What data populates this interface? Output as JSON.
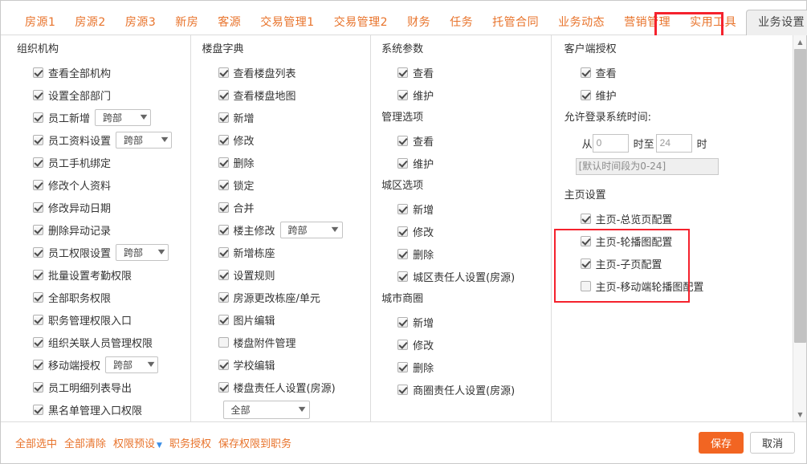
{
  "tabs": [
    {
      "label": "房源1"
    },
    {
      "label": "房源2"
    },
    {
      "label": "房源3"
    },
    {
      "label": "新房"
    },
    {
      "label": "客源"
    },
    {
      "label": "交易管理1"
    },
    {
      "label": "交易管理2"
    },
    {
      "label": "财务"
    },
    {
      "label": "任务"
    },
    {
      "label": "托管合同"
    },
    {
      "label": "业务动态"
    },
    {
      "label": "营销管理"
    },
    {
      "label": "实用工具"
    },
    {
      "label": "业务设置",
      "active": true
    }
  ],
  "columns": {
    "col1": {
      "title": "组织机构",
      "items": [
        {
          "label": "查看全部机构",
          "checked": true
        },
        {
          "label": "设置全部部门",
          "checked": true
        },
        {
          "label": "员工新增",
          "checked": true,
          "select": "跨部"
        },
        {
          "label": "员工资料设置",
          "checked": true,
          "select": "跨部"
        },
        {
          "label": "员工手机绑定",
          "checked": true
        },
        {
          "label": "修改个人资料",
          "checked": true
        },
        {
          "label": "修改异动日期",
          "checked": true
        },
        {
          "label": "删除异动记录",
          "checked": true
        },
        {
          "label": "员工权限设置",
          "checked": true,
          "select": "跨部"
        },
        {
          "label": "批量设置考勤权限",
          "checked": true
        },
        {
          "label": "全部职务权限",
          "checked": true
        },
        {
          "label": "职务管理权限入口",
          "checked": true
        },
        {
          "label": "组织关联人员管理权限",
          "checked": true
        },
        {
          "label": "移动端授权",
          "checked": true,
          "select": "跨部"
        },
        {
          "label": "员工明细列表导出",
          "checked": true
        },
        {
          "label": "黑名单管理入口权限",
          "checked": true
        }
      ]
    },
    "col2": {
      "title": "楼盘字典",
      "items": [
        {
          "label": "查看楼盘列表",
          "checked": true
        },
        {
          "label": "查看楼盘地图",
          "checked": true
        },
        {
          "label": "新增",
          "checked": true
        },
        {
          "label": "修改",
          "checked": true
        },
        {
          "label": "删除",
          "checked": true
        },
        {
          "label": "锁定",
          "checked": true
        },
        {
          "label": "合并",
          "checked": true
        },
        {
          "label": "楼主修改",
          "checked": true,
          "select": "跨部"
        },
        {
          "label": "新增栋座",
          "checked": true
        },
        {
          "label": "设置规则",
          "checked": true
        },
        {
          "label": "房源更改栋座/单元",
          "checked": true
        },
        {
          "label": "图片编辑",
          "checked": true
        },
        {
          "label": "楼盘附件管理",
          "checked": false
        },
        {
          "label": "学校编辑",
          "checked": true
        },
        {
          "label": "楼盘责任人设置(房源)",
          "checked": true
        }
      ],
      "trailing_select": "全部"
    },
    "col3": {
      "groups": [
        {
          "title": "系统参数",
          "items": [
            {
              "label": "查看",
              "checked": true
            },
            {
              "label": "维护",
              "checked": true
            }
          ]
        },
        {
          "title": "管理选项",
          "items": [
            {
              "label": "查看",
              "checked": true
            },
            {
              "label": "维护",
              "checked": true
            }
          ]
        },
        {
          "title": "城区选项",
          "items": [
            {
              "label": "新增",
              "checked": true
            },
            {
              "label": "修改",
              "checked": true
            },
            {
              "label": "删除",
              "checked": true
            },
            {
              "label": "城区责任人设置(房源)",
              "checked": true
            }
          ]
        },
        {
          "title": "城市商圈",
          "items": [
            {
              "label": "新增",
              "checked": true
            },
            {
              "label": "修改",
              "checked": true
            },
            {
              "label": "删除",
              "checked": true
            },
            {
              "label": "商圈责任人设置(房源)",
              "checked": true
            }
          ]
        }
      ]
    },
    "col4": {
      "client_auth": {
        "title": "客户端授权",
        "items": [
          {
            "label": "查看",
            "checked": true
          },
          {
            "label": "维护",
            "checked": true
          }
        ]
      },
      "login_time": {
        "title": "允许登录系统时间:",
        "from_label": "从",
        "from_value": "0",
        "mid_label": "时至",
        "to_value": "24",
        "end_label": "时",
        "hint": "[默认时间段为0-24]"
      },
      "home_settings": {
        "title": "主页设置",
        "items": [
          {
            "label": "主页-总览页配置",
            "checked": true
          },
          {
            "label": "主页-轮播图配置",
            "checked": true
          },
          {
            "label": "主页-子页配置",
            "checked": true
          }
        ]
      },
      "extra": {
        "label": "主页-移动端轮播图配置",
        "checked": false
      }
    }
  },
  "footer": {
    "links": [
      {
        "label": "全部选中"
      },
      {
        "label": "全部清除"
      },
      {
        "label": "权限预设",
        "caret": true
      },
      {
        "label": "职务授权"
      },
      {
        "label": "保存权限到职务"
      }
    ],
    "save_label": "保存",
    "cancel_label": "取消"
  },
  "colors": {
    "accent": "#e8732b",
    "primary_button": "#f26522",
    "highlight": "#f5222d"
  }
}
